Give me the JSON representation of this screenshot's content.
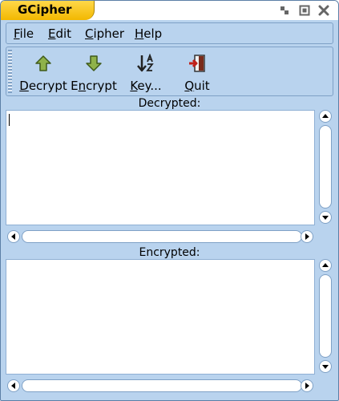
{
  "window": {
    "title": "GCipher",
    "controls": [
      "minimize-icon",
      "maximize-icon",
      "close-icon"
    ]
  },
  "menubar": {
    "items": [
      {
        "mnemonic": "F",
        "rest": "ile"
      },
      {
        "mnemonic": "E",
        "rest": "dit"
      },
      {
        "mnemonic": "C",
        "rest": "ipher"
      },
      {
        "mnemonic": "H",
        "rest": "elp"
      }
    ]
  },
  "toolbar": {
    "buttons": [
      {
        "label": "Decrypt",
        "icon": "up-arrow-icon"
      },
      {
        "label": "Encrypt",
        "icon": "down-arrow-icon"
      },
      {
        "label": "Key...",
        "icon": "key-sort-icon"
      },
      {
        "label": "Quit",
        "icon": "exit-door-icon"
      }
    ]
  },
  "decrypted": {
    "label": "Decrypted:",
    "text": ""
  },
  "encrypted": {
    "label": "Encrypted:",
    "text": ""
  },
  "colors": {
    "window_bg": "#b9d3ee",
    "title_tab": "#f2b800",
    "border": "#7fa1c6",
    "arrow_green": "#7a9a3a",
    "quit_red": "#c0201a"
  }
}
